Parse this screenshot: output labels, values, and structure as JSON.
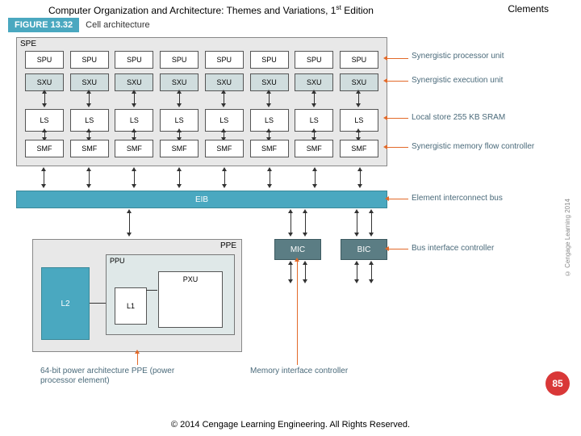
{
  "header": {
    "title_pre": "Computer Organization and Architecture: Themes and Variations, 1",
    "title_sup": "st",
    "title_post": " Edition",
    "author": "Clements"
  },
  "figure": {
    "number": "FIGURE 13.32",
    "title": "Cell architecture"
  },
  "spe": {
    "label": "SPE",
    "spu": [
      "SPU",
      "SPU",
      "SPU",
      "SPU",
      "SPU",
      "SPU",
      "SPU",
      "SPU"
    ],
    "sxu": [
      "SXU",
      "SXU",
      "SXU",
      "SXU",
      "SXU",
      "SXU",
      "SXU",
      "SXU"
    ],
    "ls": [
      "LS",
      "LS",
      "LS",
      "LS",
      "LS",
      "LS",
      "LS",
      "LS"
    ],
    "smf": [
      "SMF",
      "SMF",
      "SMF",
      "SMF",
      "SMF",
      "SMF",
      "SMF",
      "SMF"
    ]
  },
  "eib": "EIB",
  "ppe": {
    "label": "PPE",
    "ppu": "PPU",
    "l1": "L1",
    "l2": "L2",
    "pxu": "PXU"
  },
  "mic": "MIC",
  "bic": "BIC",
  "side_labels": {
    "spu": "Synergistic processor unit",
    "sxu": "Synergistic execution unit",
    "ls": "Local store 255 KB SRAM",
    "smf": "Synergistic memory flow controller",
    "eib": "Element interconnect bus",
    "bic": "Bus interface controller"
  },
  "bottom_labels": {
    "ppe": "64-bit power architecture PPE (power processor element)",
    "mic": "Memory interface controller"
  },
  "copyright_side": "© Cengage Learning 2014",
  "page": "85",
  "footer": "© 2014 Cengage Learning Engineering. All Rights Reserved."
}
